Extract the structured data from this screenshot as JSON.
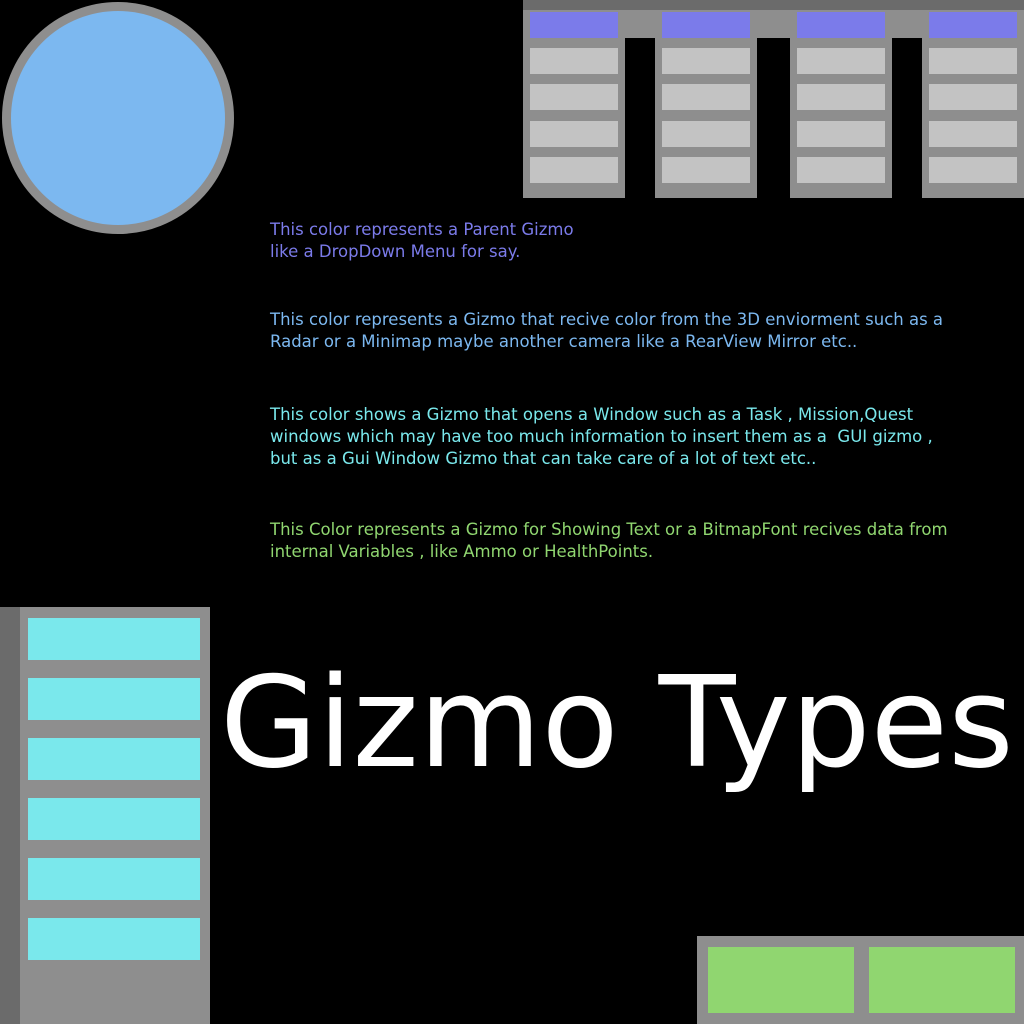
{
  "title": "Gizmo Types",
  "colors": {
    "background": "#000000",
    "frame_gray": "#8e8e8e",
    "frame_dark_gray": "#6b6b6b",
    "parent_gizmo": "#7b7bea",
    "environment_gizmo": "#7cb8f0",
    "window_gizmo": "#7ae8ec",
    "text_gizmo": "#90d670",
    "menu_item": "#c3c3c3",
    "title_text": "#ffffff"
  },
  "legend": [
    {
      "id": "parent",
      "color": "#7b7bea",
      "lines": [
        "This color represents a Parent Gizmo",
        "like a DropDown Menu for say."
      ]
    },
    {
      "id": "environment",
      "color": "#7cb8f0",
      "lines": [
        "This color represents a Gizmo that recive color from the 3D enviorment such as a",
        "Radar or a Minimap maybe another camera like a RearView Mirror etc.."
      ]
    },
    {
      "id": "window",
      "color": "#7ae8ec",
      "lines": [
        "This color shows a Gizmo that opens a Window such as a Task , Mission,Quest",
        "windows which may have too much information to insert them as a  GUI gizmo ,",
        "but as a Gui Window Gizmo that can take care of a lot of text etc.."
      ]
    },
    {
      "id": "text",
      "color": "#90d670",
      "lines": [
        "This Color represents a Gizmo for Showing Text or a BitmapFont recives data from",
        "internal Variables , like Ammo or HealthPoints."
      ]
    }
  ],
  "dropdown_menu": {
    "column_count": 4,
    "items_per_column": 4
  },
  "window_list": {
    "item_count": 6
  },
  "text_panel": {
    "box_count": 2
  }
}
